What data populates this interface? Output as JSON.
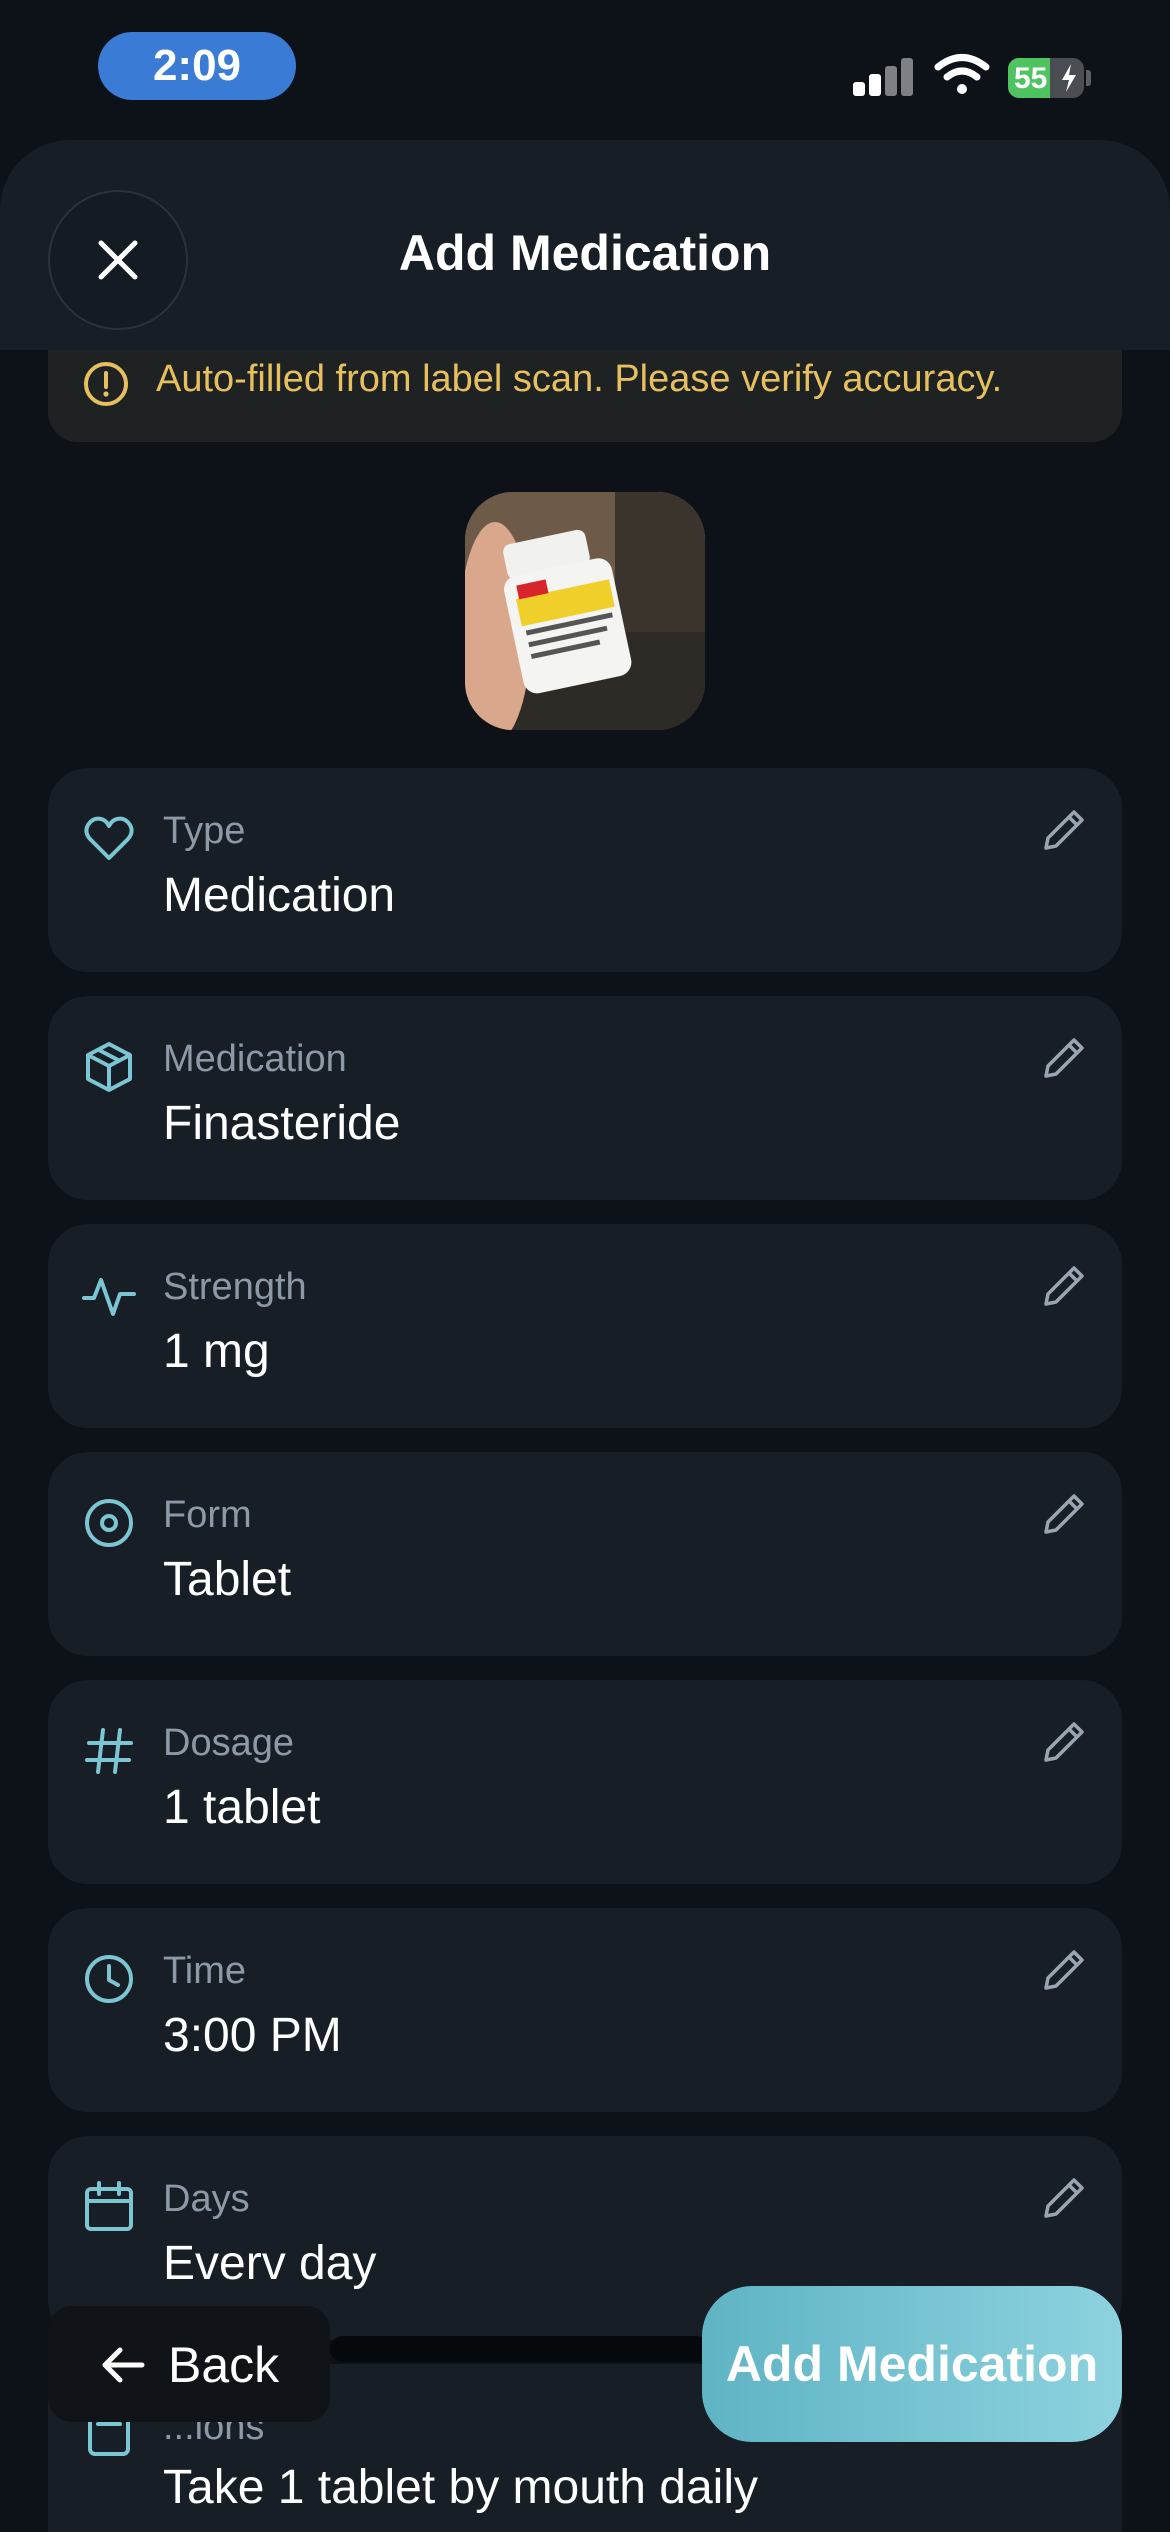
{
  "status_bar": {
    "time": "2:09",
    "battery_percent": "55",
    "battery_level": 0.55
  },
  "header": {
    "title": "Add Medication",
    "close_icon": "close-icon"
  },
  "warning": {
    "icon": "alert-circle-icon",
    "text": "Auto-filled from label scan. Please verify accuracy."
  },
  "fields": [
    {
      "icon": "heart-icon",
      "label": "Type",
      "value": "Medication"
    },
    {
      "icon": "box-icon",
      "label": "Medication",
      "value": "Finasteride"
    },
    {
      "icon": "activity-icon",
      "label": "Strength",
      "value": "1 mg"
    },
    {
      "icon": "target-icon",
      "label": "Form",
      "value": "Tablet"
    },
    {
      "icon": "hash-icon",
      "label": "Dosage",
      "value": "1 tablet"
    },
    {
      "icon": "clock-icon",
      "label": "Time",
      "value": "3:00 PM"
    },
    {
      "icon": "calendar-icon",
      "label": "Days",
      "value": "Everv day"
    },
    {
      "icon": "note-icon",
      "label": "...ions",
      "value": "Take 1 tablet by mouth daily"
    }
  ],
  "footer": {
    "back_label": "Back",
    "add_label": "Add Medication"
  },
  "colors": {
    "accent": "#7cc5d3",
    "warning": "#e6bf5f",
    "background": "#0d1218",
    "card": "#171e26"
  }
}
